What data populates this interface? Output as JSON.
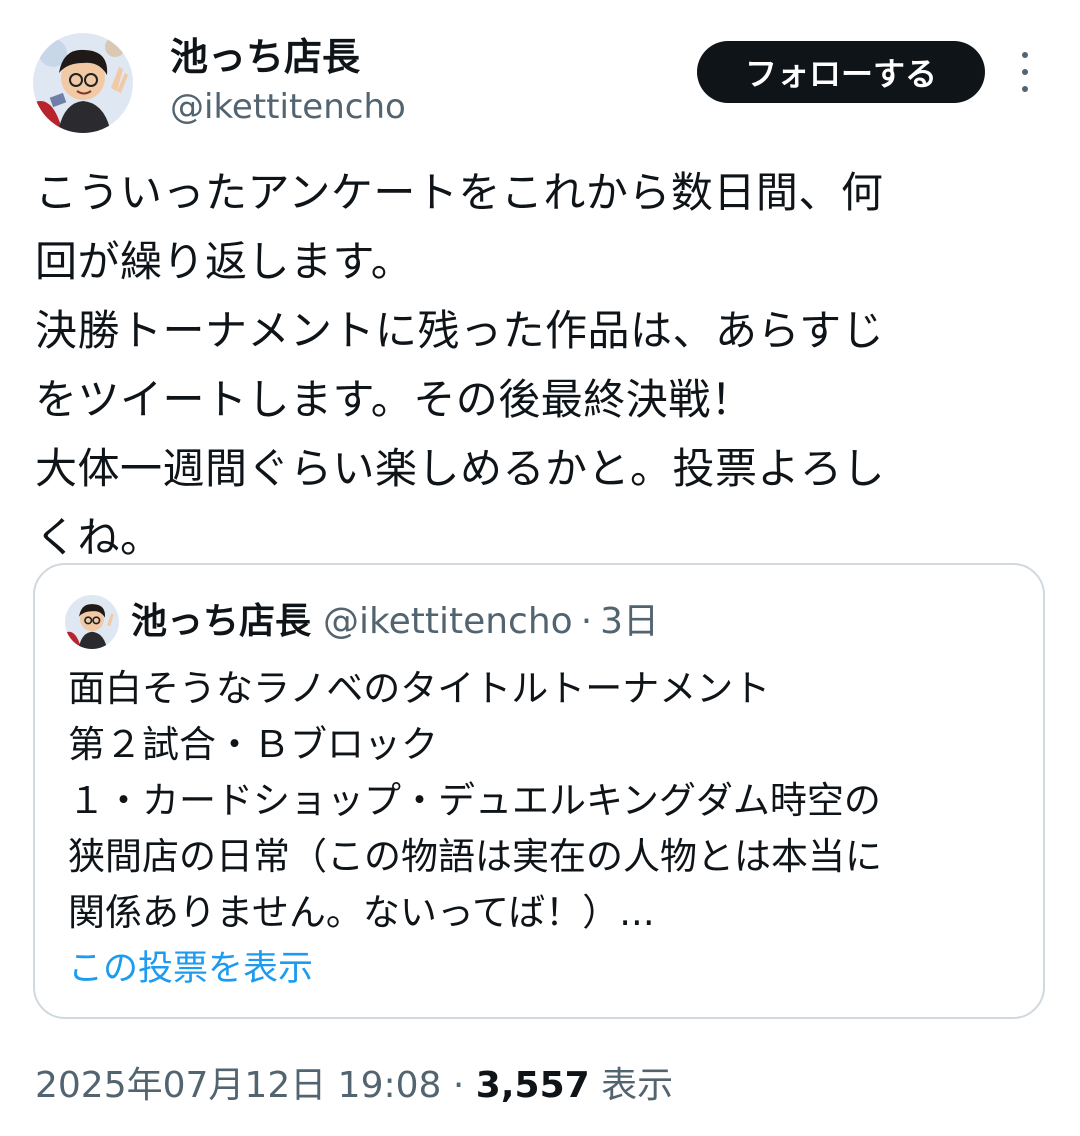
{
  "author": {
    "display_name": "池っち店長",
    "handle": "@ikettitencho",
    "avatar_icon": "user-avatar-icon"
  },
  "follow_button_label": "フォローする",
  "more_icon": "more-dots-icon",
  "tweet_lines": [
    "こういったアンケートをこれから数日間、何",
    "回が繰り返します。",
    "決勝トーナメントに残った作品は、あらすじ",
    "をツイートします。その後最終決戦！",
    "大体一週間ぐらい楽しめるかと。投票よろし",
    "くね。"
  ],
  "quote": {
    "display_name": "池っち店長",
    "handle": "@ikettitencho",
    "separator": "·",
    "time": "3日",
    "lines": [
      "面白そうなラノベのタイトルトーナメント",
      "第２試合・Ｂブロック",
      "１・カードショップ・デュエルキングダム時空の",
      "狭間店の日常（この物語は実在の人物とは本当に",
      "関係ありません。ないってば！）..."
    ],
    "poll_link": "この投票を表示"
  },
  "meta": {
    "timestamp": "2025年07月12日 19:08",
    "separator": "·",
    "views_count": "3,557",
    "views_label": "表示"
  },
  "colors": {
    "text": "#0f1419",
    "secondary": "#536471",
    "link": "#1d9bf0",
    "border": "#cfd9de",
    "button_bg": "#0f1419"
  }
}
